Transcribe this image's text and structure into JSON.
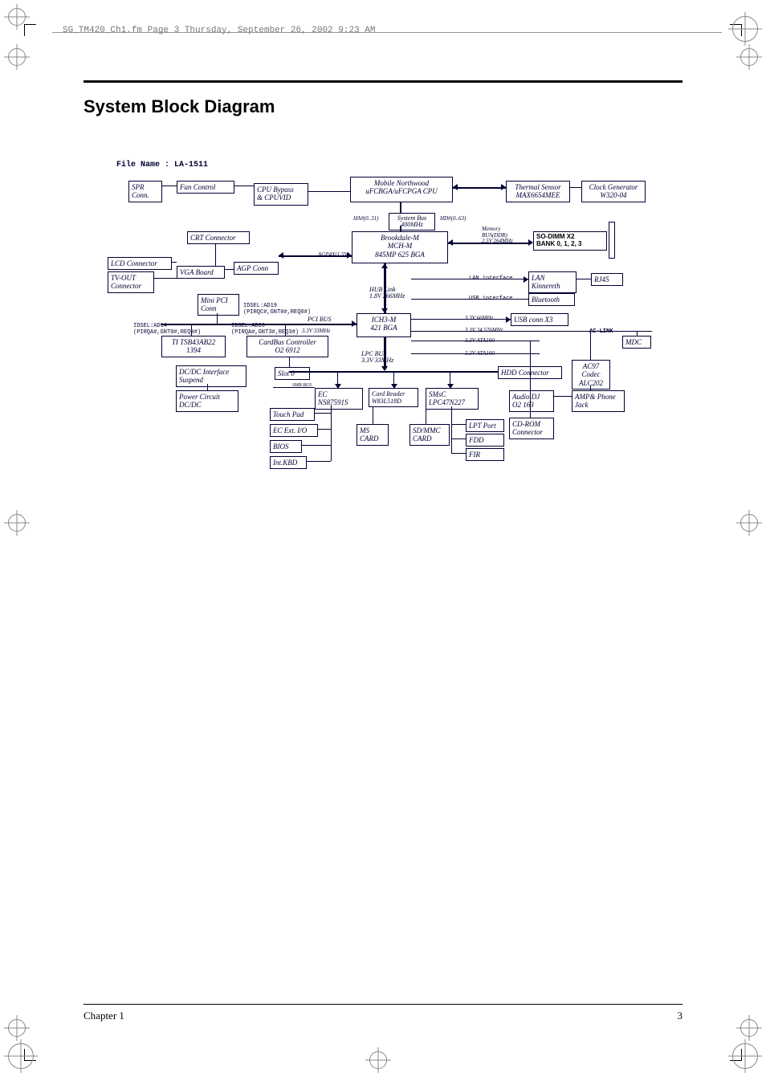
{
  "header_text": "SG_TM420_Ch1.fm  Page 3  Thursday, September 26, 2002  9:23 AM",
  "title": "System Block Diagram",
  "file_name_label": "File Name : LA-1511",
  "footer": {
    "left": "Chapter 1",
    "right": "3"
  },
  "blocks": {
    "spr_conn": "SPR\nConn.",
    "fan_control": "Fan Control",
    "cpu_bypass": "CPU Bypass\n& CPUVID",
    "mobile_northwood": "Mobile Northwood\nuFCBGA/uFCPGA CPU",
    "thermal_sensor": "Thermal Sensor\nMAX6654MEE",
    "clock_gen": "Clock Generator\nW320-04",
    "system_bus": "System Bus\n400MHz",
    "crt_conn": "CRT Connector",
    "brookdale": "Brookdale-M\nMCH-M\n845MP    625 BGA",
    "memory_bus": "Memory\nBUS(DDR)\n2.5V 264MHz",
    "sodimm": "SO-DIMM X2\nBANK 0, 1, 2, 3",
    "lcd_conn": "LCD Connector",
    "vga_board": "VGA Board",
    "agp_conn": "AGP Conn",
    "tvout": "TV-OUT\nConnector",
    "lan_kinnereth": "LAN\nKinnereth",
    "rj45": "RJ45",
    "hub_link": "HUB Link\n1.8V 266MHz",
    "mini_pci": "Mini PCI\nConn",
    "bluetooth": "Bluetooth",
    "pci_bus": "PCI BUS",
    "ich3m": "ICH3-M\n421 BGA",
    "usb_conn": "USB conn X3",
    "idsel_ad19_lbl": "IDSEL:AD19\n(PIRQC#,GNT0#,REQ0#)",
    "idsel_ad14_lbl": "IDSEL:AD14\n(PIRQA#,GNT0#,REQ0#)",
    "idsel_ad20_lbl": "IDSEL:AD20\n(PIRQA#,GNT3#,REQ3#)",
    "ti_tsb": "TI TSB43AB22\n1394",
    "cardbus": "CardBus Controller\nO2 6912",
    "mdc": "MDC",
    "lpc_bus": "LPC BUS\n3.3V 33MHz",
    "dcdc_if": "DC/DC Interface\nSuspend",
    "slot0": "Slot 0",
    "hdd_conn": "HDD Connector",
    "ac97": "AC97\nCodec\nALC202",
    "power_circuit": "Power Circuit\nDC/DC",
    "ec": "EC\nNS87591S",
    "card_reader": "Card Reader\nW83L518D",
    "smsc": "SMsC\nLPC47N227",
    "audio_dj": "Audio DJ\nO2 163",
    "amp_phone": "AMP& Phone\nJack",
    "touch_pad": "Touch Pad",
    "ec_ext_io": "EC Ext. I/O",
    "ms_card": "MS\nCARD",
    "sdmmc": "SD/MMC\nCARD",
    "lpt": "LPT Port",
    "cdrom": "CD-ROM\nConnector",
    "fdd": "FDD",
    "bios": "BIOS",
    "fir": "FIR",
    "int_kbd": "Int.KBD"
  },
  "labels": {
    "ha0_31": "HA#(0..31)",
    "hd0_63": "HD#(0..63)",
    "agp4x": "AGP4X(1.5V)",
    "lan_if": "LAN interface",
    "usb_if": "USB interface",
    "u33v66": "3.3V 66MHz",
    "u33v33": "3.3V 33MHz",
    "u33v24": "3.3V 24.576MHz",
    "ata1": "3.3V ATA100",
    "ata2": "3.3V ATA100",
    "aclink": "AC-LINK",
    "smbus": "SMB  BUS"
  }
}
